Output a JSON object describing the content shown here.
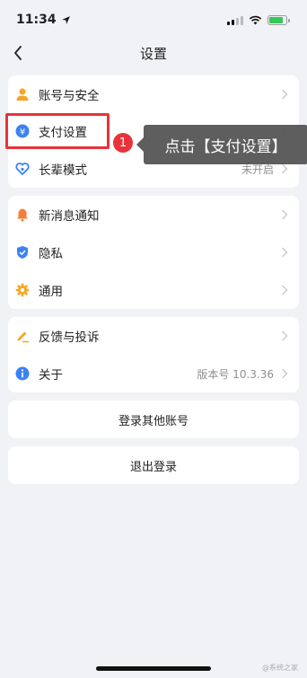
{
  "status": {
    "time": "11:34"
  },
  "nav": {
    "title": "设置"
  },
  "groups": [
    {
      "rows": [
        {
          "label": "账号与安全",
          "value": "",
          "icon": "person-icon",
          "color": "#f5a623"
        },
        {
          "label": "支付设置",
          "value": "",
          "icon": "yuan-icon",
          "color": "#3b82f6"
        },
        {
          "label": "长辈模式",
          "value": "未开启",
          "icon": "heart-icon",
          "color": "#3b82f6"
        }
      ]
    },
    {
      "rows": [
        {
          "label": "新消息通知",
          "value": "",
          "icon": "bell-icon",
          "color": "#f57e3a"
        },
        {
          "label": "隐私",
          "value": "",
          "icon": "shield-icon",
          "color": "#3b82f6"
        },
        {
          "label": "通用",
          "value": "",
          "icon": "gear-icon",
          "color": "#f5a623"
        }
      ]
    },
    {
      "rows": [
        {
          "label": "反馈与投诉",
          "value": "",
          "icon": "pen-icon",
          "color": "#f5a623"
        },
        {
          "label": "关于",
          "value": "版本号 10.3.36",
          "icon": "info-icon",
          "color": "#3b82f6"
        }
      ]
    }
  ],
  "actions": {
    "login_other": "登录其他账号",
    "logout": "退出登录"
  },
  "annotation": {
    "step": "1",
    "text": "点击【支付设置】",
    "accent": "#e8333a"
  },
  "watermark": "@系统之家"
}
